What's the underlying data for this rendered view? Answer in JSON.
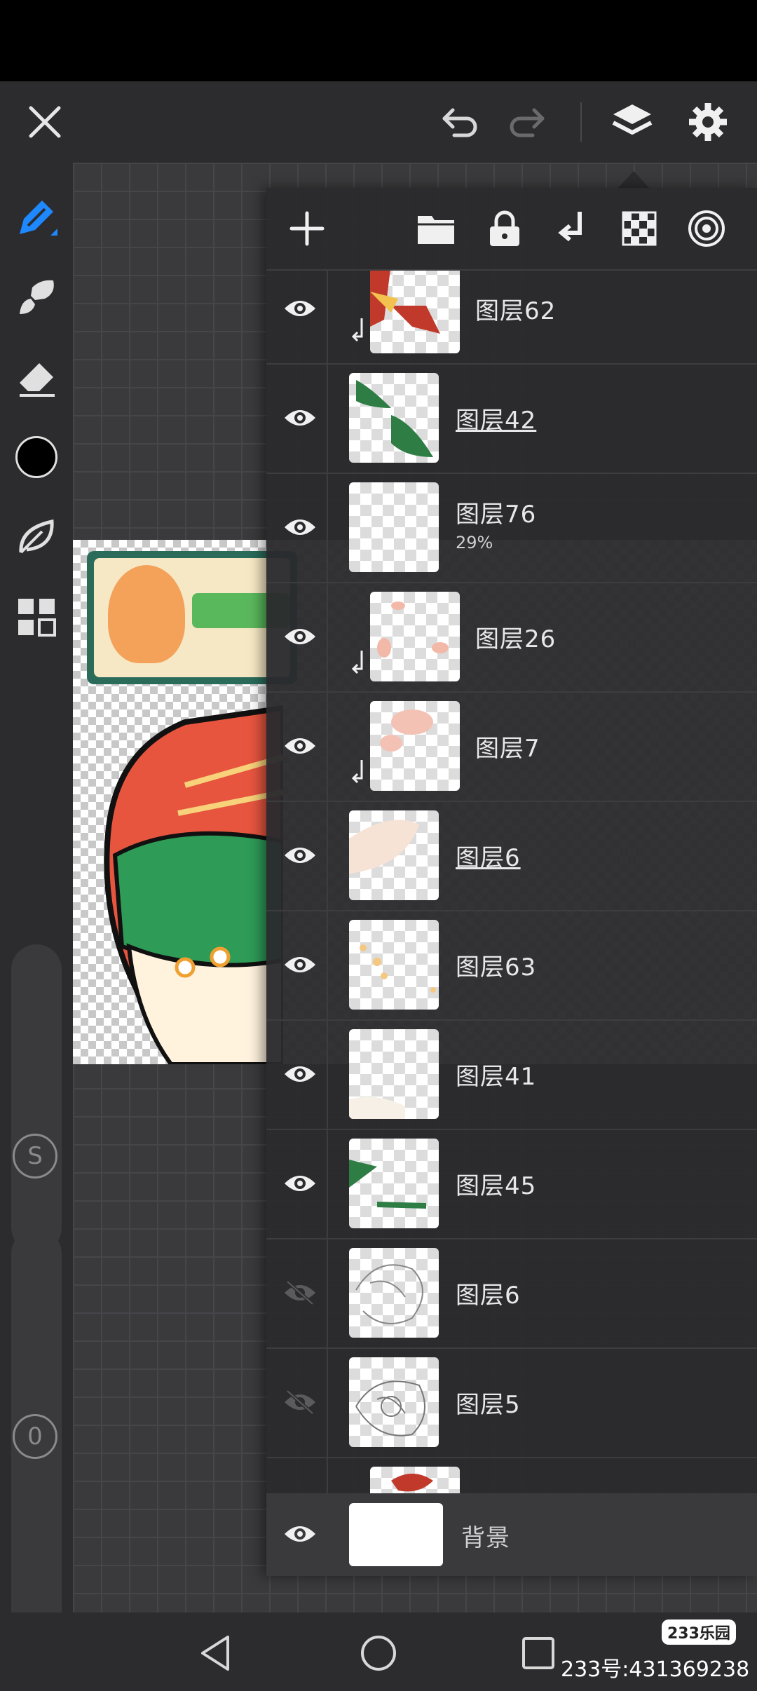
{
  "topbar": {
    "close": "close-icon",
    "undo": "undo-icon",
    "redo": "redo-icon",
    "layers": "layers-icon",
    "settings": "gear-icon"
  },
  "tools": [
    "pen-icon",
    "brush-icon",
    "eraser-icon",
    "color-swatch",
    "leaf-icon",
    "grid-icon"
  ],
  "sliders": {
    "size_label": "S",
    "opacity_label": "0"
  },
  "layer_panel": {
    "toolbar": [
      "add-icon",
      "folder-icon",
      "lock-icon",
      "merge-down-icon",
      "checker-icon",
      "target-icon"
    ],
    "layers": [
      {
        "name": "图层62",
        "visible": true,
        "clipped": true
      },
      {
        "name": "图层42",
        "visible": true,
        "clipped": false,
        "underlined": true
      },
      {
        "name": "图层76",
        "visible": true,
        "clipped": false,
        "opacity": "29%"
      },
      {
        "name": "图层26",
        "visible": true,
        "clipped": true
      },
      {
        "name": "图层7",
        "visible": true,
        "clipped": true
      },
      {
        "name": "图层6",
        "visible": true,
        "clipped": false,
        "underlined": true
      },
      {
        "name": "图层63",
        "visible": true,
        "clipped": false
      },
      {
        "name": "图层41",
        "visible": true,
        "clipped": false
      },
      {
        "name": "图层45",
        "visible": true,
        "clipped": false
      },
      {
        "name": "图层6",
        "visible": false,
        "clipped": false
      },
      {
        "name": "图层5",
        "visible": false,
        "clipped": false
      }
    ],
    "background": {
      "name": "背景",
      "visible": true
    }
  },
  "navbar": {
    "back": "back-icon",
    "home": "home-icon",
    "recents": "recents-icon"
  },
  "watermark": {
    "badge": "233乐园",
    "text": "233号:431369238"
  },
  "colors": {
    "accent": "#1e88ff",
    "panel": "#2b2b2e",
    "current_color": "#000000"
  }
}
